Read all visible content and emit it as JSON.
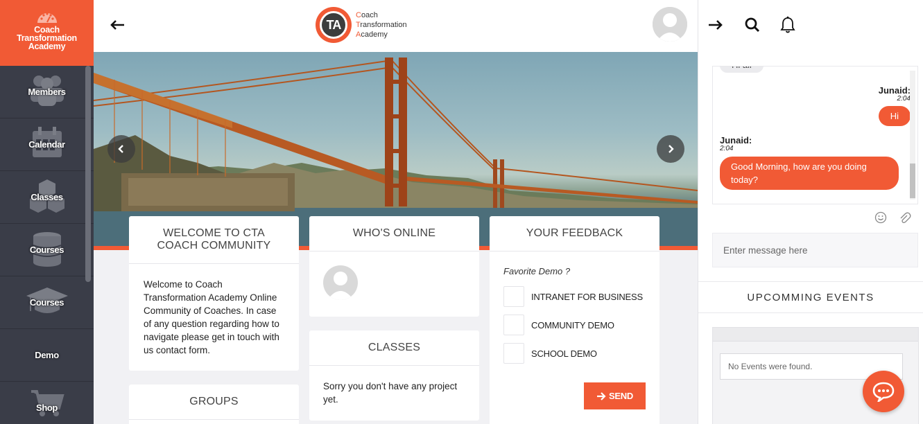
{
  "brand": {
    "name": "Coach Transformation Academy"
  },
  "sidebar": {
    "items": [
      {
        "label": "Members",
        "icon": "members-icon"
      },
      {
        "label": "Calendar",
        "icon": "calendar-icon"
      },
      {
        "label": "Classes",
        "icon": "classes-cubes-icon"
      },
      {
        "label": "Courses",
        "icon": "database-icon"
      },
      {
        "label": "Courses",
        "icon": "graduation-cap-icon"
      },
      {
        "label": "Demo",
        "icon": ""
      },
      {
        "label": "Shop",
        "icon": "cart-icon"
      }
    ]
  },
  "header": {
    "logo_initials": "TA",
    "logo_lines": [
      "Coach",
      "Transformation",
      "Academy"
    ]
  },
  "cards": {
    "welcome": {
      "title": "WELCOME TO CTA COACH COMMUNITY",
      "body": "Welcome to Coach Transformation Academy Online Community of Coaches. In case of any question regarding how to navigate please get in touch with us contact form."
    },
    "online": {
      "title": "WHO'S ONLINE"
    },
    "classes": {
      "title": "CLASSES",
      "body": "Sorry you don't have any project yet."
    },
    "groups": {
      "title": "GROUPS"
    },
    "feedback": {
      "title": "YOUR FEEDBACK",
      "question": "Favorite Demo ?",
      "options": [
        "INTRANET FOR BUSINESS",
        "COMMUNITY DEMO",
        "SCHOOL DEMO"
      ],
      "send_label": "SEND"
    }
  },
  "chat": {
    "messages": [
      {
        "text": "Hi all"
      },
      {
        "name": "Junaid:",
        "time": "2:04",
        "text": "Hi"
      },
      {
        "name": "Junaid:",
        "time": "2:04",
        "text": "Good Morning, how are you doing today?"
      }
    ],
    "input_placeholder": "Enter message here"
  },
  "events": {
    "title": "UPCOMMING EVENTS",
    "empty_text": "No Events were found."
  },
  "colors": {
    "accent": "#f15a35",
    "sidebar": "#3a3d48"
  }
}
